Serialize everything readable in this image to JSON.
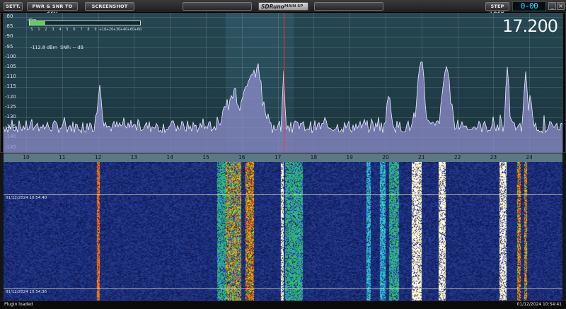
{
  "toolbar": {
    "settings_label": "SETT.",
    "pwr_snr_label": "PWR & SNR TO CSV",
    "screenshot_label": "SCREENSHOT",
    "app_logo": "SDRuno",
    "panel_title": "MAIN SP",
    "step_lock_label": "STEP LOCK",
    "counter_value": "0-00",
    "minimize_glyph": "_",
    "close_glyph": "×"
  },
  "spectrum": {
    "db_unit": "dBm",
    "db_labels": [
      "-80",
      "-85",
      "-90",
      "-95",
      "-100",
      "-105",
      "-110",
      "-115",
      "-120",
      "-125",
      "-130",
      "-135",
      "-140",
      "-145"
    ],
    "smeter_scale": [
      "S",
      "1",
      "2",
      "3",
      "4",
      "5",
      "6",
      "7",
      "8",
      "9",
      "+10",
      "+20",
      "+30",
      "+40",
      "+60",
      "+60"
    ],
    "smeter_level": 0.14,
    "readout": "-112.8 dBm  SNR: -- dB",
    "frequency_display": "17.200"
  },
  "axis": {
    "labels": [
      "10",
      "11",
      "12",
      "13",
      "14",
      "15",
      "16",
      "17",
      "18",
      "19",
      "20",
      "21",
      "22",
      "23",
      "24"
    ]
  },
  "waterfall": {
    "timestamp_1": "01/12/2024 10:54:40",
    "timestamp_2": "01/12/2024 10:54:36"
  },
  "status": {
    "left": "Plugin loaded",
    "right": "01/12/2024 10:54:41"
  },
  "colors": {
    "spectrum_fill": "#8a8cc8",
    "spectrum_line": "#e8ecff",
    "marker": "#ff3030",
    "waterfall_bg": "#1a2a8a"
  }
}
